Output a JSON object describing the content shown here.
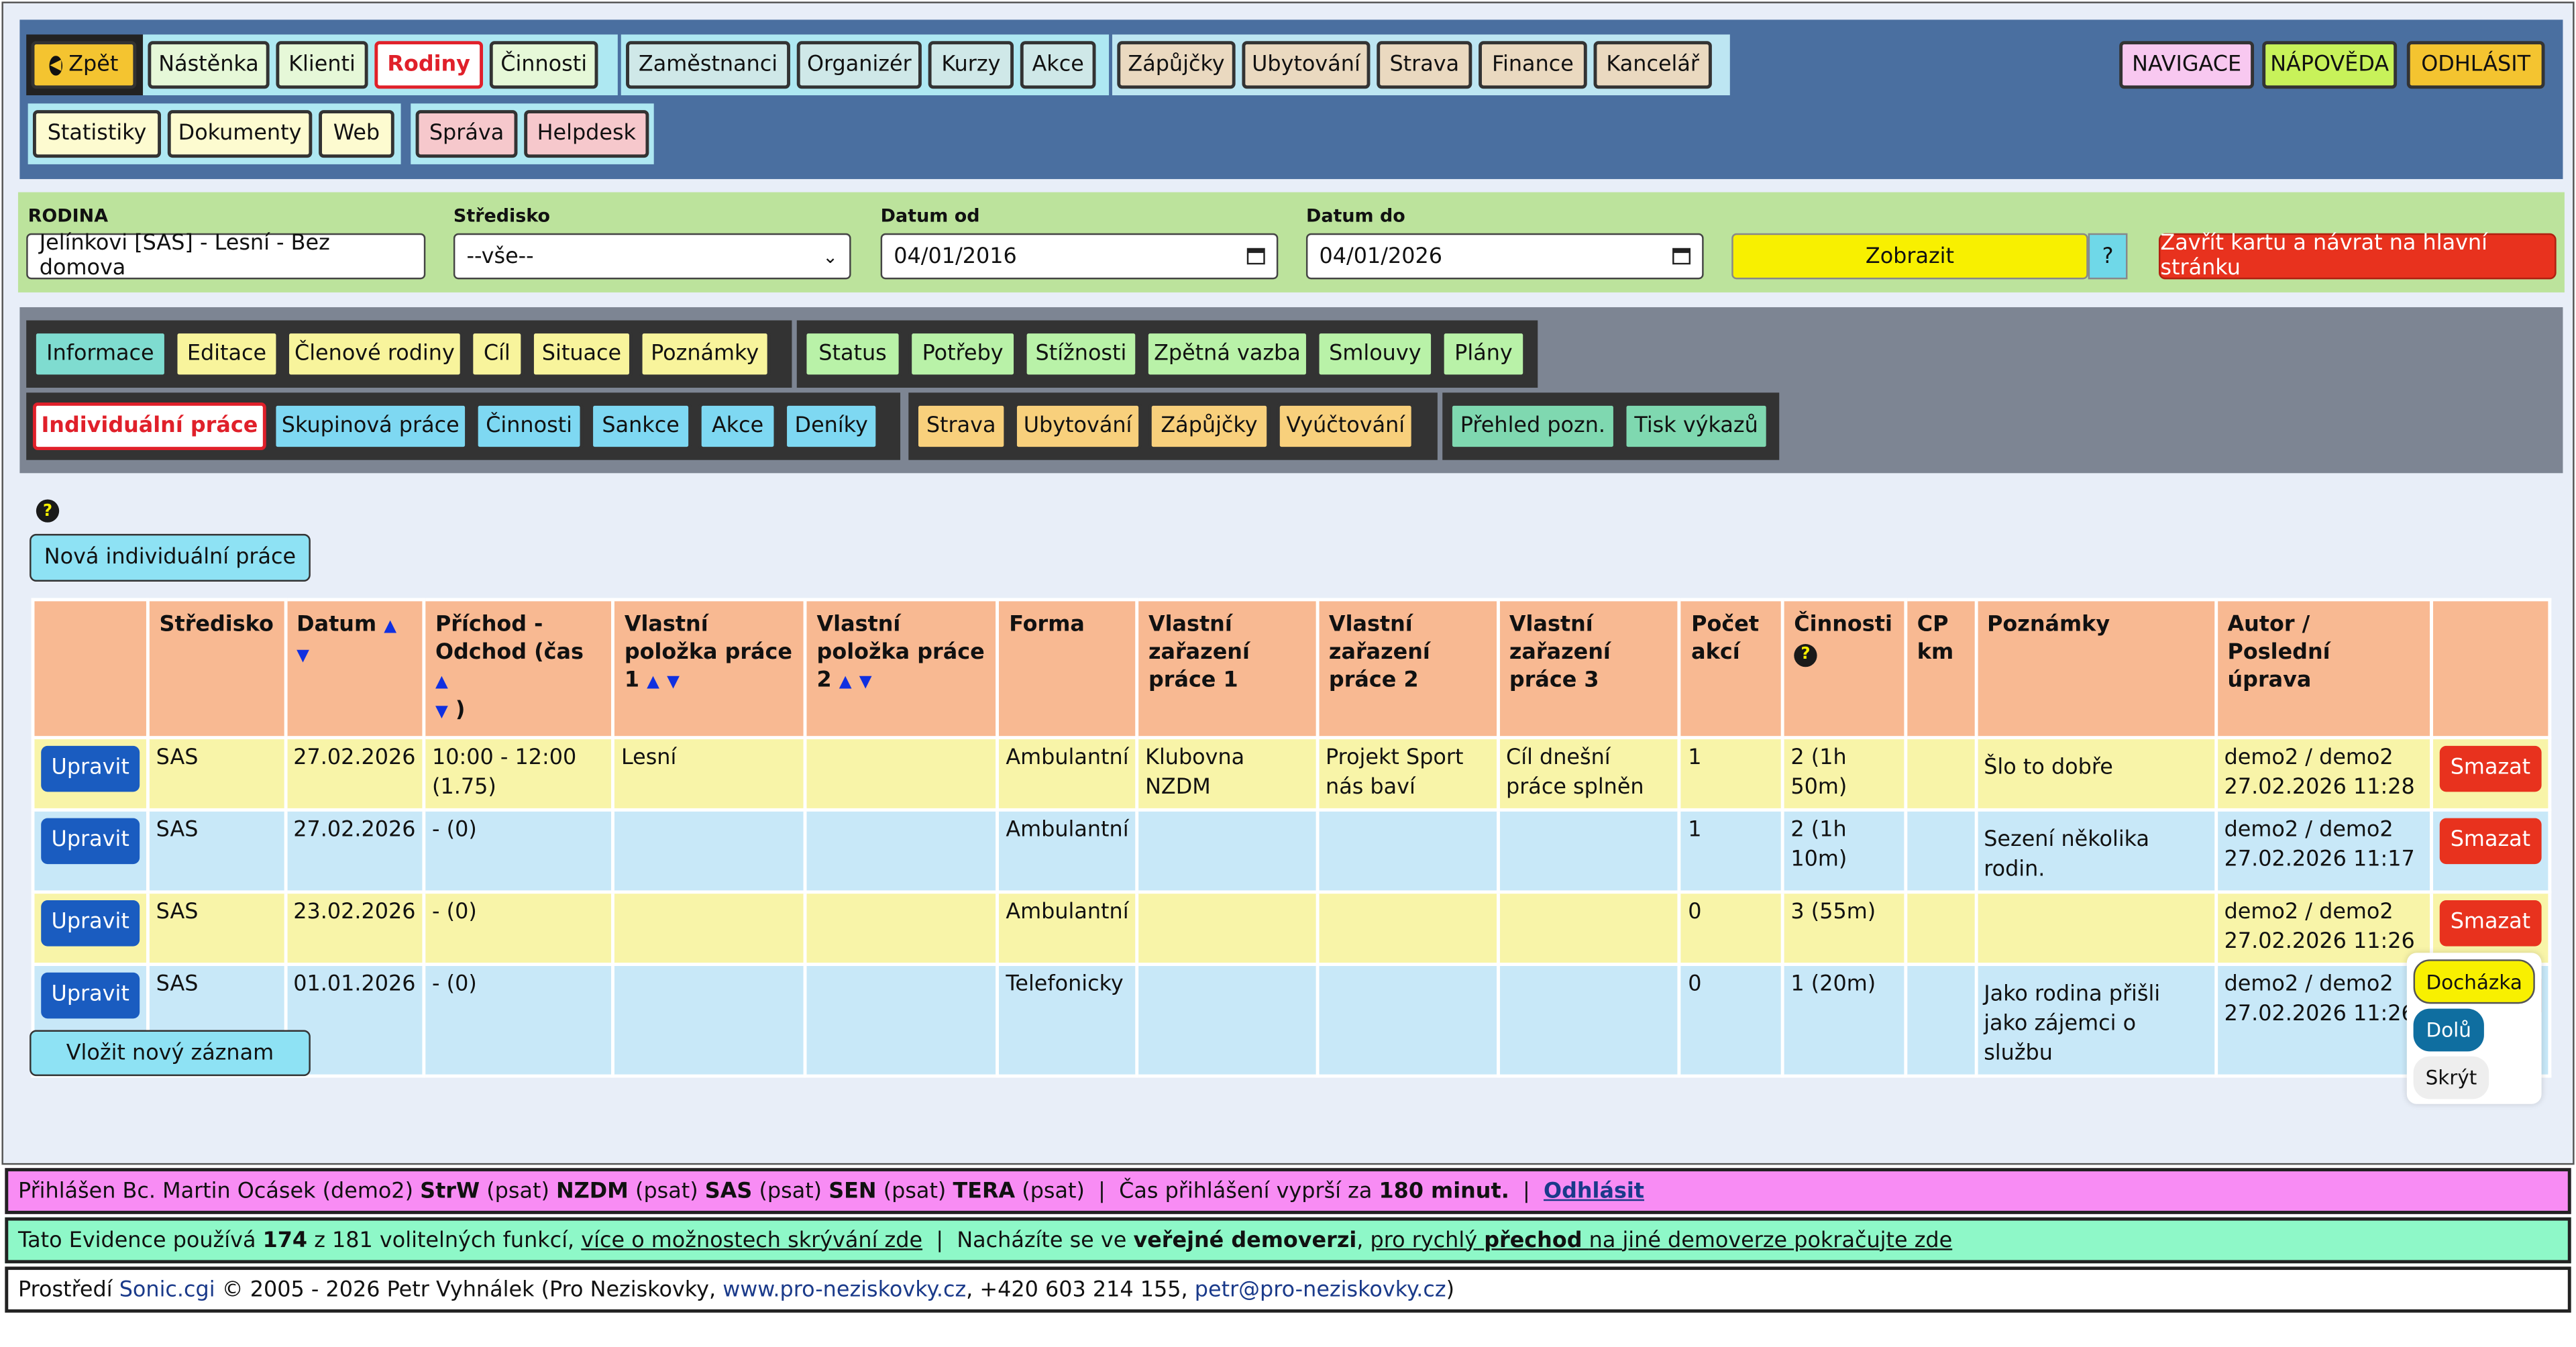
{
  "topnav": {
    "back": "Zpět",
    "row1_group1": [
      "Nástěnka",
      "Klienti",
      "Rodiny",
      "Činnosti"
    ],
    "row1_group2": [
      "Zaměstnanci",
      "Organizér",
      "Kurzy",
      "Akce"
    ],
    "row1_group3": [
      "Zápůjčky",
      "Ubytování",
      "Strava",
      "Finance",
      "Kancelář"
    ],
    "right": {
      "navigation": "NAVIGACE",
      "help": "NÁPOVĚDA",
      "logout": "ODHLÁSIT"
    },
    "row2_group1": [
      "Statistiky",
      "Dokumenty",
      "Web"
    ],
    "row2_group2": [
      "Správa",
      "Helpdesk"
    ]
  },
  "filter": {
    "family_label": "RODINA",
    "family_value": "Jelínkovi [SAS] - Lesní - Bez domova",
    "center_label": "Středisko",
    "center_value": "--vše--",
    "date_from_label": "Datum od",
    "date_from_value": "04/01/2016",
    "date_to_label": "Datum do",
    "date_to_value": "04/01/2026",
    "show": "Zobrazit",
    "question": "?",
    "close": "Zavřít kartu a návrat na hlavní stránku"
  },
  "tabs": {
    "row1a": [
      "Informace",
      "Editace",
      "Členové rodiny",
      "Cíl",
      "Situace",
      "Poznámky"
    ],
    "row1b": [
      "Status",
      "Potřeby",
      "Stížnosti",
      "Zpětná vazba",
      "Smlouvy",
      "Plány"
    ],
    "row2a": [
      "Individuální práce",
      "Skupinová práce",
      "Činnosti",
      "Sankce",
      "Akce",
      "Deníky"
    ],
    "row2b": [
      "Strava",
      "Ubytování",
      "Zápůjčky",
      "Vyúčtování"
    ],
    "row2c": [
      "Přehled pozn.",
      "Tisk výkazů"
    ]
  },
  "content": {
    "help_glyph": "?",
    "new_button": "Nová individuální práce",
    "insert_button": "Vložit nový záznam"
  },
  "table": {
    "headers": {
      "center": "Středisko",
      "date": "Datum",
      "arrival": "Příchod - Odchod (čas",
      "item1": "Vlastní položka práce 1",
      "item2": "Vlastní položka práce 2",
      "form": "Forma",
      "class1": "Vlastní zařazení práce 1",
      "class2": "Vlastní zařazení práce 2",
      "class3": "Vlastní zařazení práce 3",
      "count": "Počet akcí",
      "activities": "Činnosti",
      "cp": "CP km",
      "notes": "Poznámky",
      "author": "Autor / Poslední úprava"
    },
    "sort_up": "▲",
    "sort_down": "▼",
    "close_paren": ")",
    "edit_label": "Upravit",
    "delete_label": "Smazat",
    "rows": [
      {
        "center": "SAS",
        "date": "27.02.2026",
        "arrival": "10:00 - 12:00 (1.75)",
        "item1": "Lesní",
        "item2": "",
        "form": "Ambulantní",
        "class1": "Klubovna NZDM",
        "class2": "Projekt Sport nás baví",
        "class3": "Cíl dnešní práce splněn",
        "count": "1",
        "activities": "2 (1h 50m)",
        "cp": "",
        "notes": "Šlo to dobře",
        "author": "demo2 / demo2 27.02.2026 11:28"
      },
      {
        "center": "SAS",
        "date": "27.02.2026",
        "arrival": "- (0)",
        "item1": "",
        "item2": "",
        "form": "Ambulantní",
        "class1": "",
        "class2": "",
        "class3": "",
        "count": "1",
        "activities": "2 (1h 10m)",
        "cp": "",
        "notes": "Sezení několika rodin.",
        "author": "demo2 / demo2 27.02.2026 11:17"
      },
      {
        "center": "SAS",
        "date": "23.02.2026",
        "arrival": "- (0)",
        "item1": "",
        "item2": "",
        "form": "Ambulantní",
        "class1": "",
        "class2": "",
        "class3": "",
        "count": "0",
        "activities": "3 (55m)",
        "cp": "",
        "notes": "",
        "author": "demo2 / demo2 27.02.2026 11:26"
      },
      {
        "center": "SAS",
        "date": "01.01.2026",
        "arrival": "- (0)",
        "item1": "",
        "item2": "",
        "form": "Telefonicky",
        "class1": "",
        "class2": "",
        "class3": "",
        "count": "0",
        "activities": "1 (20m)",
        "cp": "",
        "notes": "Jako rodina přišli jako zájemci o službu",
        "author": "demo2 / demo2 27.02.2026 11:26"
      }
    ]
  },
  "floating": {
    "attendance": "Docházka",
    "down": "Dolů",
    "hide": "Skrýt"
  },
  "footer": {
    "l1_a": "Přihlášen Bc. Martin Ocásek (demo2)",
    "l1_strw": "StrW",
    "l1_psat": "(psat)",
    "l1_nzdm": "NZDM",
    "l1_sas": "SAS",
    "l1_sen": "SEN",
    "l1_tera": "TERA",
    "l1_sep": "|",
    "l1_time": "Čas přihlášení vyprší za",
    "l1_minutes": "180 minut.",
    "l1_logout": "Odhlásit",
    "l2_a": "Tato Evidence používá",
    "l2_count": "174",
    "l2_b": "z 181 volitelných funkcí,",
    "l2_more": "více o možnostech skrývání zde",
    "l2_c": "Nacházíte se ve",
    "l2_public": "veřejné demoverzi",
    "l2_quick_a": "pro rychlý",
    "l2_quick_b": "přechod",
    "l2_quick_c": "na jiné demoverze pokračujte zde",
    "l3_a": "Prostředí",
    "l3_sonic": "Sonic.cgi",
    "l3_b": "© 2005 - 2026 Petr Vyhnálek (Pro Neziskovky,",
    "l3_web": "www.pro-neziskovky.cz",
    "l3_c": ", +420 603 214 155,",
    "l3_mail": "petr@pro-neziskovky.cz",
    "l3_d": ")"
  }
}
